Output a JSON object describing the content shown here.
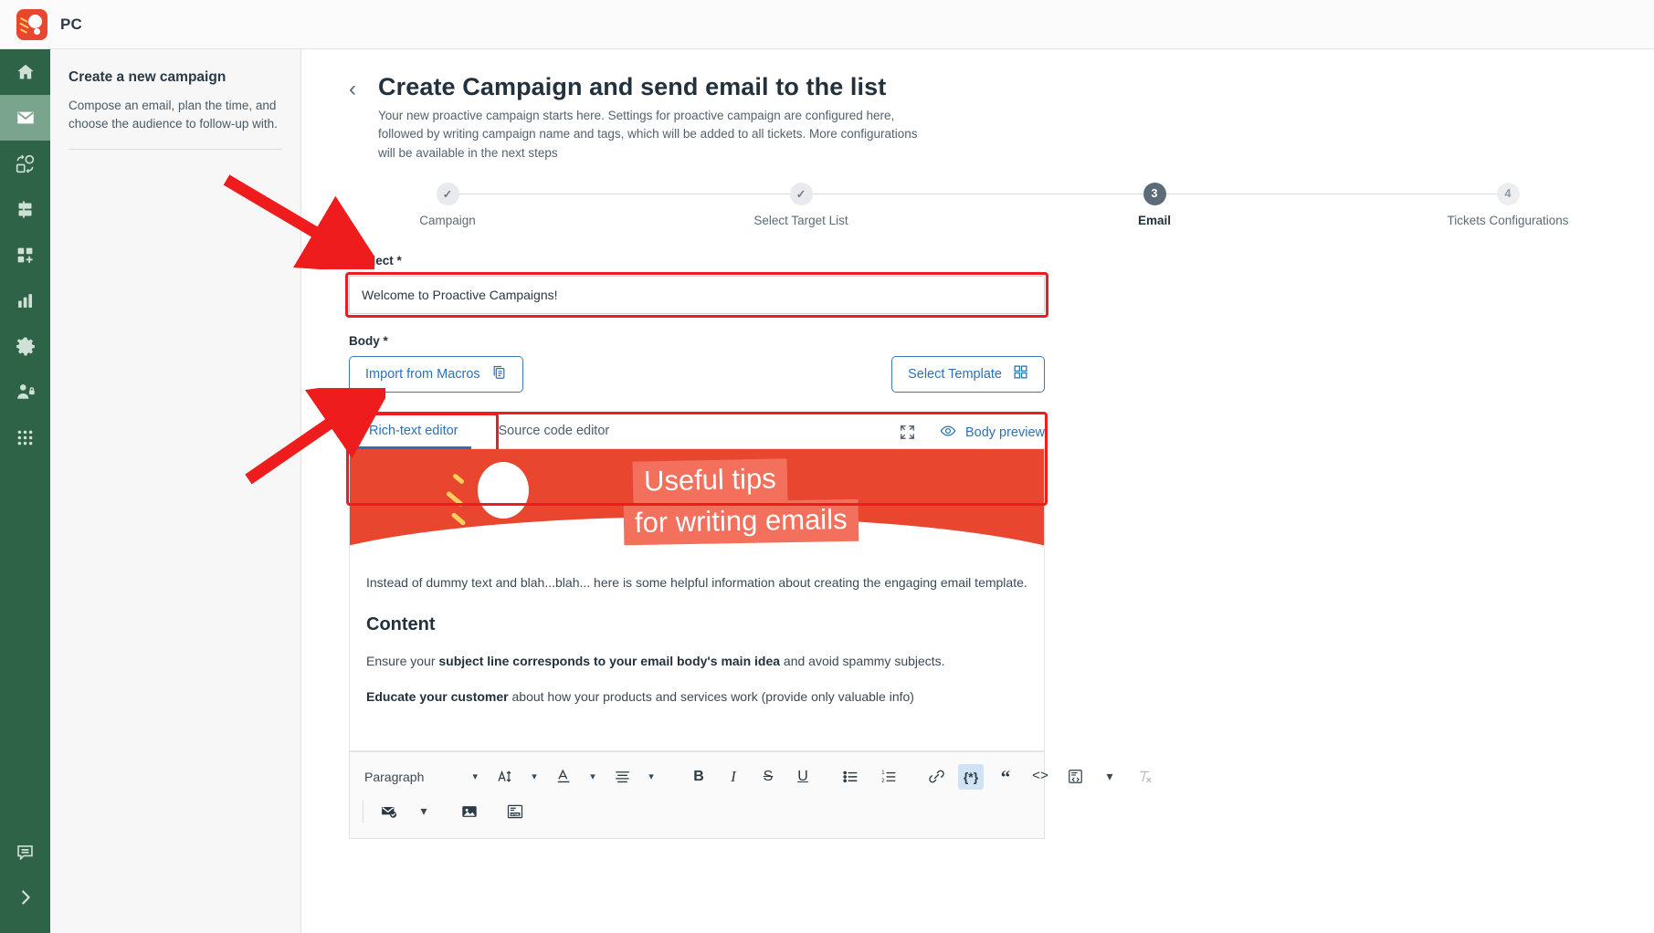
{
  "topbar": {
    "brand": "PC",
    "logo_icon": "proactive-campaigns-logo"
  },
  "leftnav": {
    "items": [
      {
        "name": "home",
        "icon": "home-icon",
        "active": false
      },
      {
        "name": "mail",
        "icon": "mail-icon",
        "active": true
      },
      {
        "name": "automation",
        "icon": "sync-objects-icon",
        "active": false
      },
      {
        "name": "database",
        "icon": "database-icon",
        "active": false
      },
      {
        "name": "add-app",
        "icon": "grid-plus-icon",
        "active": false
      },
      {
        "name": "reports",
        "icon": "bar-chart-icon",
        "active": false
      },
      {
        "name": "settings",
        "icon": "gear-icon",
        "active": false
      },
      {
        "name": "user-access",
        "icon": "user-lock-icon",
        "active": false
      },
      {
        "name": "apps",
        "icon": "dots-grid-icon",
        "active": false
      }
    ],
    "bottom": [
      {
        "name": "feedback",
        "icon": "comment-icon"
      },
      {
        "name": "expand-sidebar",
        "icon": "chevron-right-icon"
      }
    ]
  },
  "subpanel": {
    "title": "Create a new campaign",
    "description": "Compose an email, plan the time, and choose the audience to follow-up with."
  },
  "header": {
    "back_icon": "chevron-left-icon",
    "title": "Create Campaign and send email to the list",
    "subtitle": "Your new proactive campaign starts here. Settings for proactive campaign are configured here, followed by writing campaign name and tags, which will be added to all tickets. More configurations will be available in the next steps"
  },
  "stepper": {
    "steps": [
      {
        "label": "Campaign",
        "badge": "✓",
        "state": "done"
      },
      {
        "label": "Select Target List",
        "badge": "✓",
        "state": "done"
      },
      {
        "label": "Email",
        "badge": "3",
        "state": "current"
      },
      {
        "label": "Tickets Configurations",
        "badge": "4",
        "state": "upcoming"
      }
    ]
  },
  "form": {
    "subject": {
      "label": "Subject *",
      "value": "Welcome to Proactive Campaigns!",
      "placeholder": "Subject"
    },
    "body": {
      "label": "Body *",
      "import_macros_label": "Import from Macros",
      "import_macros_icon": "copy-document-icon",
      "select_template_label": "Select Template",
      "select_template_icon": "grid-squares-icon"
    }
  },
  "editor": {
    "tabs": [
      {
        "label": "Rich-text editor",
        "active": true
      },
      {
        "label": "Source code editor",
        "active": false
      }
    ],
    "expand_icon": "fullscreen-icon",
    "preview_icon": "eye-icon",
    "preview_label": "Body preview"
  },
  "email_content": {
    "banner": {
      "line1": "Useful tips",
      "line2": "for writing emails"
    },
    "intro": "Instead of dummy text and blah...blah... here is some helpful information about creating the engaging email template.",
    "heading": "Content",
    "para1_prefix": "Ensure your ",
    "para1_bold": "subject line corresponds to your email body's main idea",
    "para1_suffix": " and avoid spammy subjects.",
    "para2_bold": "Educate your customer",
    "para2_suffix": " about how your products and services work (provide only valuable info)"
  },
  "toolbar": {
    "row1": {
      "paragraph_label": "Paragraph",
      "paragraph_chevron": "chevron-down-icon",
      "font_size_icon": "font-size-icon",
      "font_size_chevron": "chevron-down-icon",
      "font_color_icon": "font-color-icon",
      "font_color_chevron": "chevron-down-icon",
      "align_icon": "align-icon",
      "align_chevron": "chevron-down-icon",
      "bold_icon": "bold-icon",
      "bold_label": "B",
      "italic_icon": "italic-icon",
      "italic_label": "I",
      "strike_icon": "strikethrough-icon",
      "strike_label": "S",
      "underline_icon": "underline-icon",
      "underline_label": "U",
      "bullet_list_icon": "bullet-list-icon",
      "numbered_list_icon": "numbered-list-icon",
      "link_icon": "link-icon",
      "placeholder_icon": "placeholder-braces-icon",
      "placeholder_label": "{*}",
      "quote_icon": "blockquote-icon",
      "code_icon": "code-icon",
      "code_label": "<>",
      "embed_icon": "embed-html-icon",
      "more_chevron": "chevron-down-icon",
      "clear_format_icon": "clear-formatting-icon"
    },
    "row2": {
      "signature_icon": "email-signature-icon",
      "signature_chevron": "chevron-down-icon",
      "image_icon": "insert-image-icon",
      "html_icon": "insert-html-icon"
    }
  },
  "annotations": {
    "arrow_color": "#ee1c1c",
    "highlights": [
      "subject-input",
      "rich-text-editor-tab",
      "editor-toolbar"
    ]
  },
  "colors": {
    "brand_red": "#e8462f",
    "nav_green": "#2e6347",
    "nav_active_green": "#7ba48e",
    "link_blue": "#2a72b5",
    "annotation_red": "#ee1c1c"
  }
}
